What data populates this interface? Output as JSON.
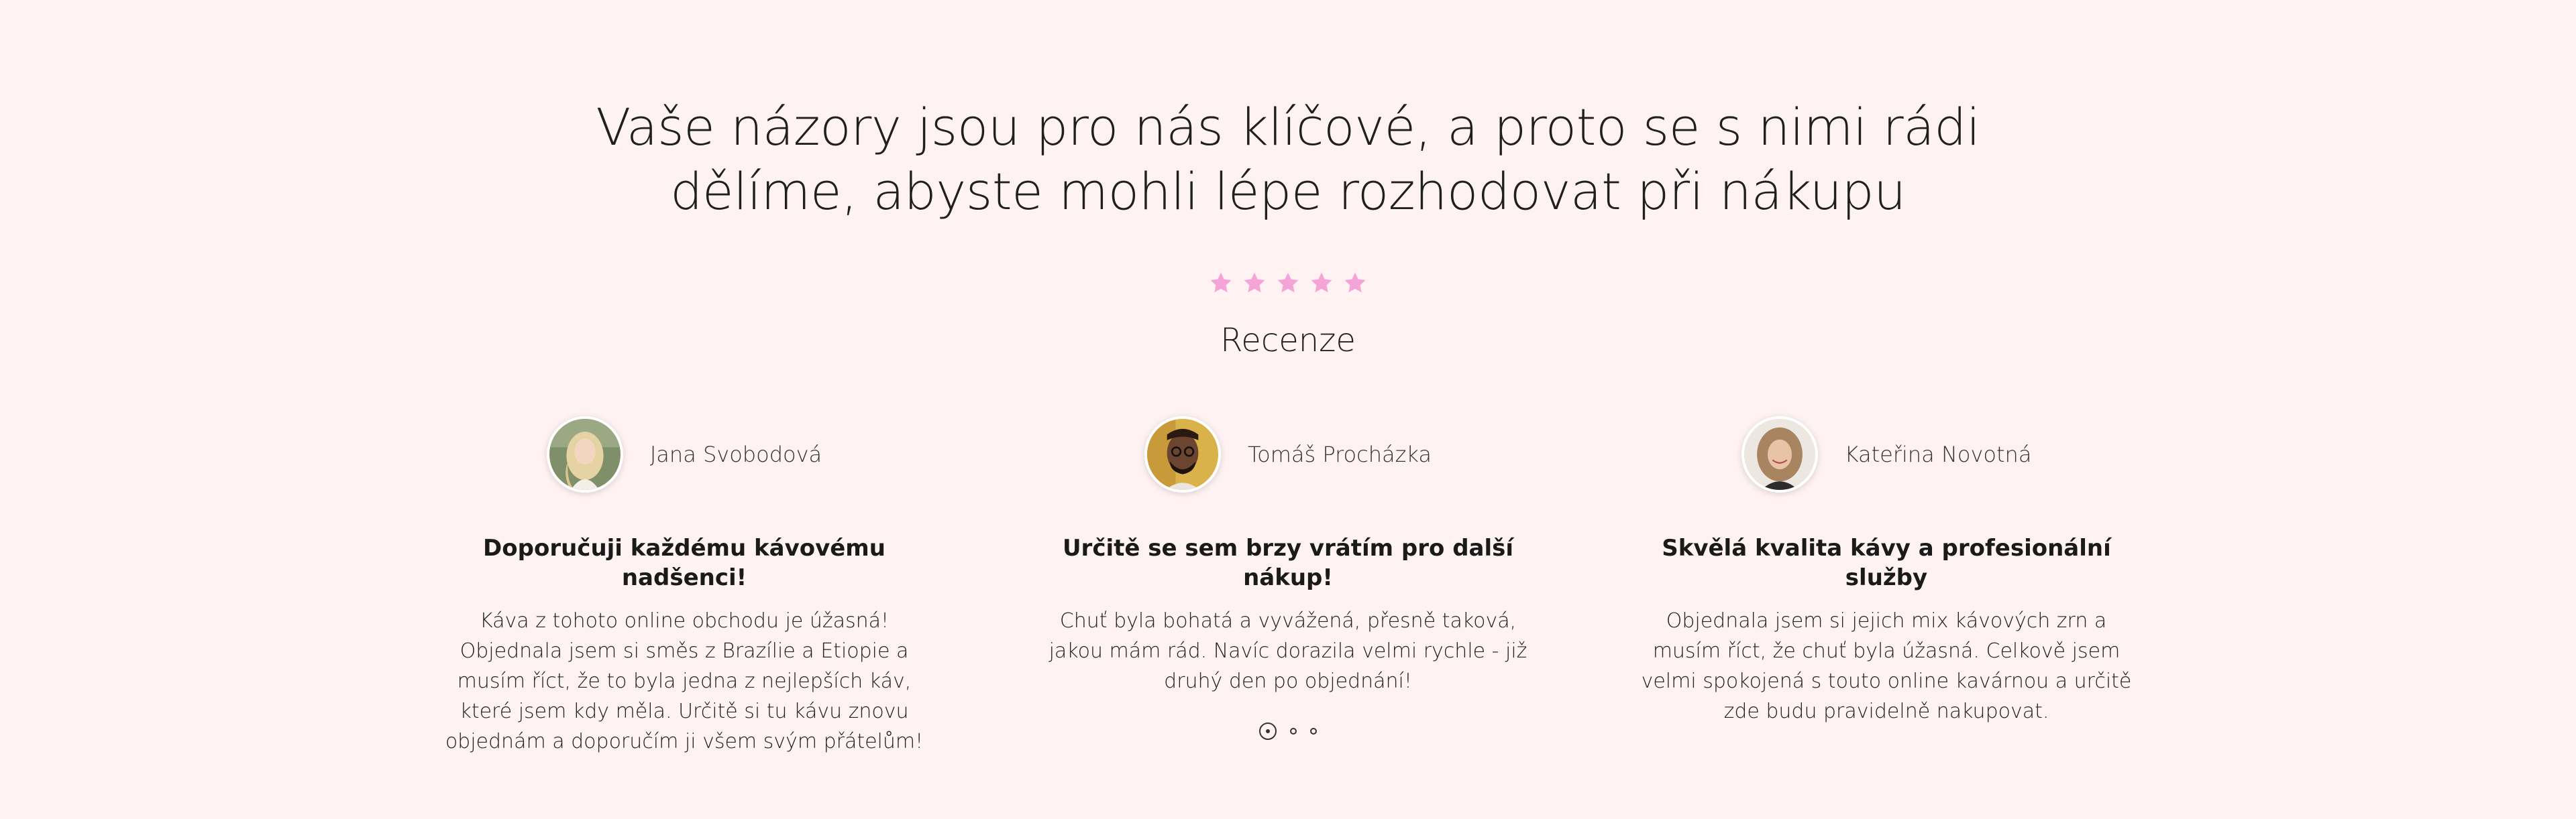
{
  "heading": {
    "line1": "Vaše názory jsou pro nás klíčové, a proto se s nimi rádi",
    "line2": "dělíme, abyste mohli lépe rozhodovat při nákupu"
  },
  "rating": {
    "value": 5,
    "max": 5,
    "star_color": "#f5a3d8"
  },
  "reviews_label": "Recenze",
  "reviews": [
    {
      "name": "Jana Svobodová",
      "avatar_icon": "avatar-photo-woman-blonde",
      "title": "Doporučuji každému kávovému nadšenci!",
      "text": "Káva z tohoto online obchodu je úžasná! Objednala jsem si směs z Brazílie a Etiopie a musím říct, že to byla jedna z nejlepších káv, které jsem kdy měla. Určitě si tu kávu znovu objednám a doporučím ji všem svým přátelům!"
    },
    {
      "name": "Tomáš Procházka",
      "avatar_icon": "avatar-photo-man-glasses",
      "title": "Určitě se sem brzy vrátím pro další nákup!",
      "text": "Chuť byla bohatá a vyvážená, přesně taková, jakou mám rád. Navíc dorazila velmi rychle - již druhý den po objednání!"
    },
    {
      "name": "Kateřina Novotná",
      "avatar_icon": "avatar-photo-woman-curly",
      "title": "Skvělá kvalita kávy a profesionální služby",
      "text": "Objednala jsem si jejich mix kávových zrn a musím říct, že chuť byla úžasná. Celkově jsem velmi spokojená s touto online kavárnou a určitě zde budu pravidelně nakupovat."
    }
  ],
  "pagination": {
    "current": 1,
    "total": 3
  }
}
